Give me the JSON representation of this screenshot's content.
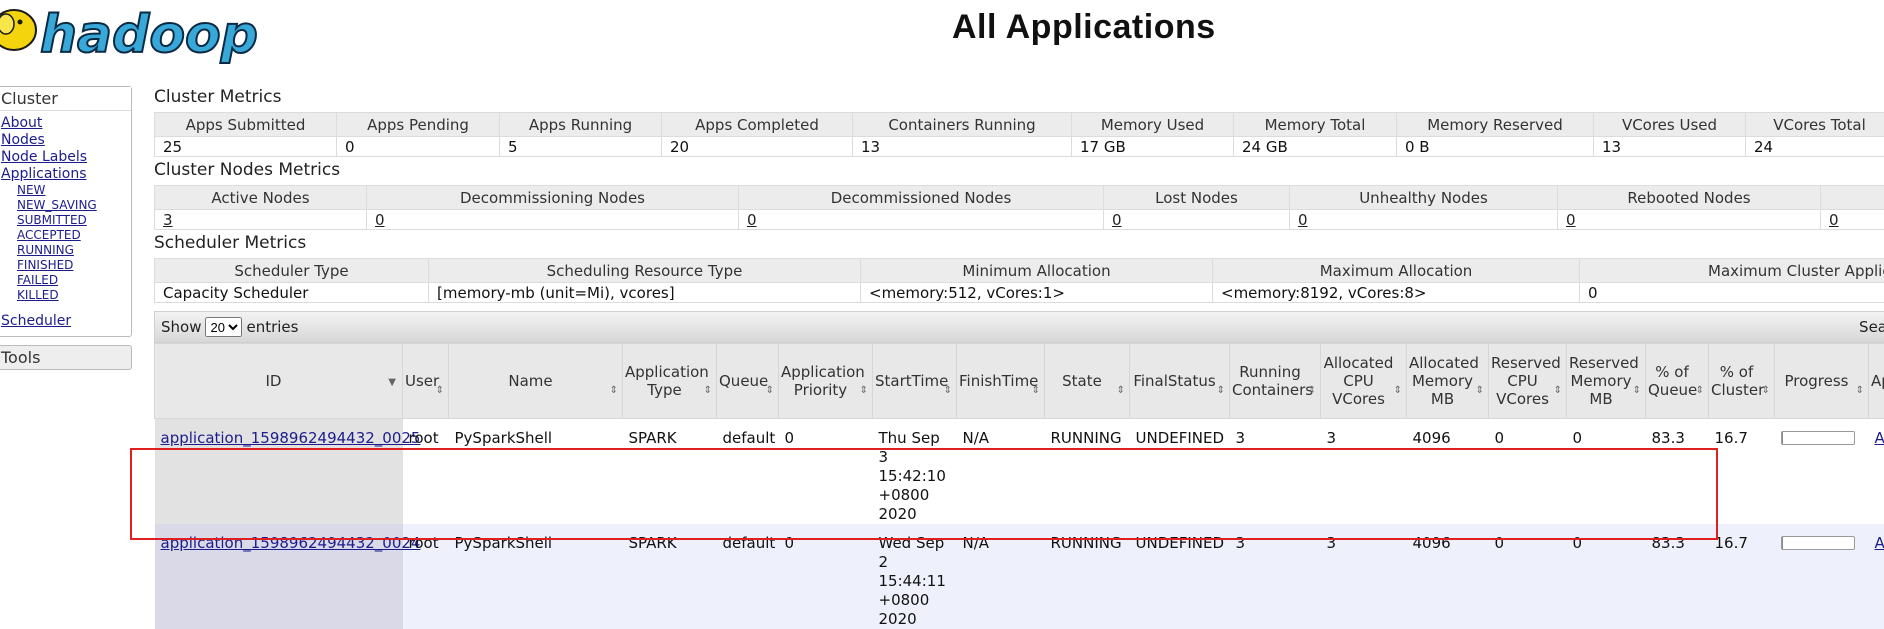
{
  "header": {
    "title": "All Applications",
    "logo_text": "hadoop"
  },
  "nav": {
    "cluster_label": "Cluster",
    "links": [
      "About",
      "Nodes",
      "Node Labels",
      "Applications"
    ],
    "sub_links": [
      "NEW",
      "NEW_SAVING",
      "SUBMITTED",
      "ACCEPTED",
      "RUNNING",
      "FINISHED",
      "FAILED",
      "KILLED"
    ],
    "scheduler_label": "Scheduler",
    "tools_label": "Tools"
  },
  "cluster_metrics": {
    "title": "Cluster Metrics",
    "headers": [
      "Apps Submitted",
      "Apps Pending",
      "Apps Running",
      "Apps Completed",
      "Containers Running",
      "Memory Used",
      "Memory Total",
      "Memory Reserved",
      "VCores Used",
      "VCores Total"
    ],
    "values": [
      "25",
      "0",
      "5",
      "20",
      "13",
      "17 GB",
      "24 GB",
      "0 B",
      "13",
      "24"
    ]
  },
  "cluster_nodes_metrics": {
    "title": "Cluster Nodes Metrics",
    "headers": [
      "Active Nodes",
      "Decommissioning Nodes",
      "Decommissioned Nodes",
      "Lost Nodes",
      "Unhealthy Nodes",
      "Rebooted Nodes"
    ],
    "values": [
      "3",
      "0",
      "0",
      "0",
      "0",
      "0",
      "0"
    ]
  },
  "scheduler_metrics": {
    "title": "Scheduler Metrics",
    "headers": [
      "Scheduler Type",
      "Scheduling Resource Type",
      "Minimum Allocation",
      "Maximum Allocation",
      "Maximum Cluster Applica"
    ],
    "values": [
      "Capacity Scheduler",
      "[memory-mb (unit=Mi), vcores]",
      "<memory:512, vCores:1>",
      "<memory:8192, vCores:8>",
      "0"
    ]
  },
  "table_controls": {
    "show_label": "Show",
    "entries_value": "20",
    "entries_label": "entries",
    "search_label": "Sea"
  },
  "apps_table": {
    "columns": [
      "ID",
      "User",
      "Name",
      "Application Type",
      "Queue",
      "Application Priority",
      "StartTime",
      "FinishTime",
      "State",
      "FinalStatus",
      "Running Containers",
      "Allocated CPU VCores",
      "Allocated Memory MB",
      "Reserved CPU VCores",
      "Reserved Memory MB",
      "% of Queue",
      "% of Cluster",
      "Progress",
      "Ap"
    ],
    "rows": [
      {
        "id": "application_1598962494432_0025",
        "user": "root",
        "name": "PySparkShell",
        "type": "SPARK",
        "queue": "default",
        "priority": "0",
        "start": "Thu Sep 3 15:42:10 +0800 2020",
        "finish": "N/A",
        "state": "RUNNING",
        "final_status": "UNDEFINED",
        "running_containers": "3",
        "alloc_vcores": "3",
        "alloc_mem": "4096",
        "res_vcores": "0",
        "res_mem": "0",
        "pct_queue": "83.3",
        "pct_cluster": "16.7",
        "progress": 0.02,
        "tracking": "Ap"
      },
      {
        "id": "application_1598962494432_0024",
        "user": "root",
        "name": "PySparkShell",
        "type": "SPARK",
        "queue": "default",
        "priority": "0",
        "start": "Wed Sep 2 15:44:11 +0800 2020",
        "finish": "N/A",
        "state": "RUNNING",
        "final_status": "UNDEFINED",
        "running_containers": "3",
        "alloc_vcores": "3",
        "alloc_mem": "4096",
        "res_vcores": "0",
        "res_mem": "0",
        "pct_queue": "83.3",
        "pct_cluster": "16.7",
        "progress": 0.02,
        "tracking": "Ap"
      }
    ]
  },
  "colors": {
    "highlight": "#e02020",
    "logo_blue": "#38a8d8",
    "logo_yellow": "#f4d40c"
  }
}
